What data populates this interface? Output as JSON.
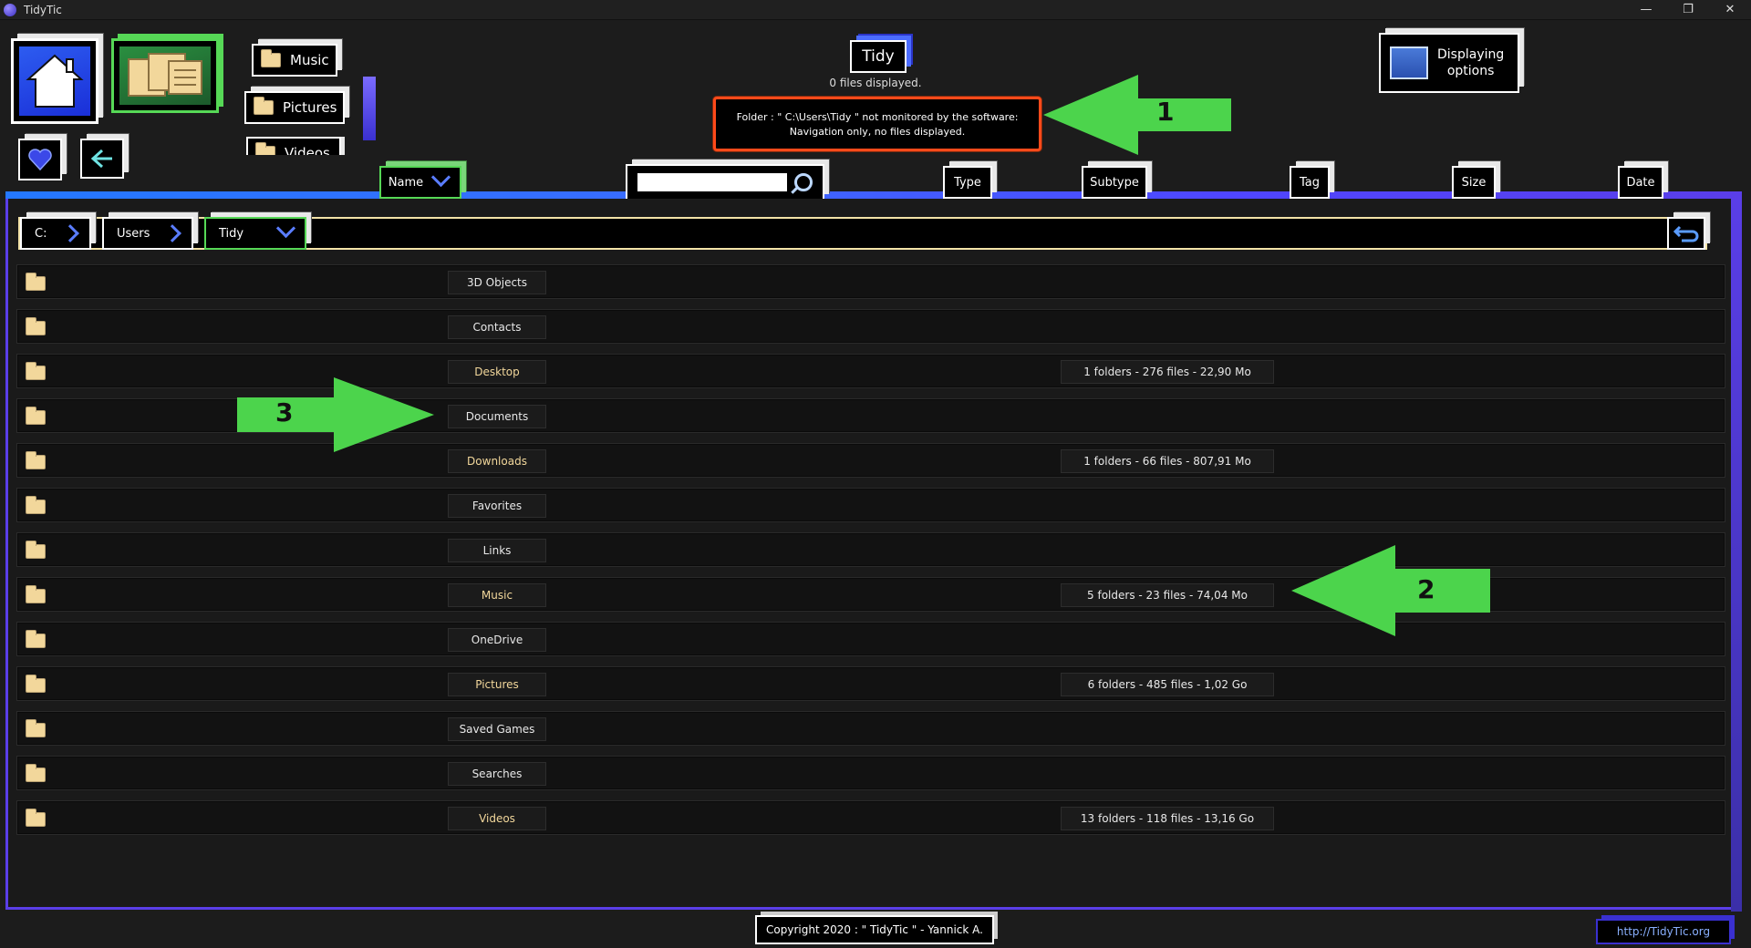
{
  "window": {
    "title": "TidyTic",
    "controls": [
      "—",
      "❐",
      "✕"
    ]
  },
  "shortcuts": [
    {
      "label": "Music"
    },
    {
      "label": "Pictures"
    },
    {
      "label": "Videos"
    }
  ],
  "tidy": {
    "label": "Tidy",
    "files_displayed": "0 files displayed."
  },
  "warning": {
    "line1": "Folder : \" C:\\Users\\Tidy \" not monitored by the software:",
    "line2": "Navigation only, no files displayed."
  },
  "display_options": {
    "label_line1": "Displaying",
    "label_line2": "options"
  },
  "columns": {
    "name": "Name",
    "search_placeholder": "",
    "type": "Type",
    "subtype": "Subtype",
    "tag": "Tag",
    "size": "Size",
    "date": "Date"
  },
  "breadcrumb": [
    {
      "label": "C:"
    },
    {
      "label": "Users"
    },
    {
      "label": "Tidy"
    }
  ],
  "rows": [
    {
      "name": "3D Objects",
      "info": "",
      "highlight": false
    },
    {
      "name": "Contacts",
      "info": "",
      "highlight": false
    },
    {
      "name": "Desktop",
      "info": "1 folders  -  276 files  -  22,90 Mo",
      "highlight": true
    },
    {
      "name": "Documents",
      "info": "",
      "highlight": false
    },
    {
      "name": "Downloads",
      "info": "1 folders  -  66 files  -  807,91 Mo",
      "highlight": true
    },
    {
      "name": "Favorites",
      "info": "",
      "highlight": false
    },
    {
      "name": "Links",
      "info": "",
      "highlight": false
    },
    {
      "name": "Music",
      "info": "5 folders  -  23 files  -  74,04 Mo",
      "highlight": true
    },
    {
      "name": "OneDrive",
      "info": "",
      "highlight": false
    },
    {
      "name": "Pictures",
      "info": "6 folders  -  485 files  -  1,02 Go",
      "highlight": true
    },
    {
      "name": "Saved Games",
      "info": "",
      "highlight": false
    },
    {
      "name": "Searches",
      "info": "",
      "highlight": false
    },
    {
      "name": "Videos",
      "info": "13 folders  -  118 files  -  13,16 Go",
      "highlight": true
    }
  ],
  "annotations": {
    "a1": "1",
    "a2": "2",
    "a3": "3"
  },
  "footer": {
    "copyright": "Copyright 2020 : \" TidyTic \" - Yannick A.",
    "link": "http://TidyTic.org"
  },
  "colors": {
    "accent_blue": "#2478ff",
    "accent_purple": "#5a3ee8",
    "warning": "#ff4a1a",
    "highlight_name": "#f2d79b",
    "annotation": "#4cd44c"
  }
}
